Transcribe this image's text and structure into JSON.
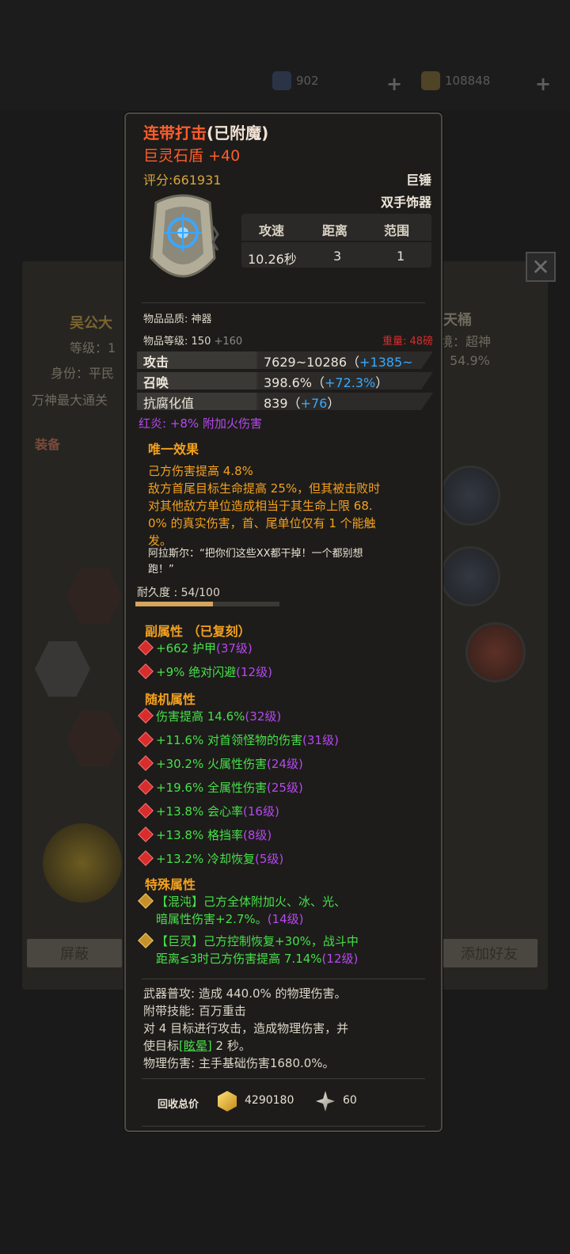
{
  "background": {
    "currency1": "902",
    "currency2": "108848",
    "left_name": "吴公大",
    "left_level": "等级：1",
    "left_identity": "身份：平民",
    "left_title": "万神最大通关",
    "right_name": "天桶",
    "right_realm": "境：超神",
    "right_percent": "54.9%",
    "equip_label": "装备",
    "block_button": "屏蔽",
    "add_friend_button": "添加好友"
  },
  "item": {
    "enchant_name": "连带打击",
    "enchant_state": "(已附魔)",
    "name": "巨灵石盾",
    "level_plus": "+40",
    "score": "评分:661931",
    "category": "巨锤",
    "slot": "双手饰器",
    "stat_headers": [
      "攻速",
      "距离",
      "范围"
    ],
    "stat_values": [
      "10.26秒",
      "3",
      "1"
    ],
    "quality": "物品品质: 神器",
    "level_label": "物品等级:",
    "level_value": "150",
    "level_bonus": "+160",
    "weight": "重量: 48磅",
    "main_stats": [
      {
        "label": "攻击",
        "value": "7629~10286（",
        "bonus": "+1385~",
        "close": ""
      },
      {
        "label": "召唤",
        "value": "398.6%（",
        "bonus": "+72.3%",
        "close": "）"
      },
      {
        "label": "抗腐化值",
        "value": "839（",
        "bonus": "+76",
        "close": "）"
      }
    ],
    "fire_line": "红炎: +8% 附加火伤害",
    "unique_title": "唯一效果",
    "unique_lines": [
      "己方伤害提高 4.8%",
      "敌方首尾目标生命提高 25%，但其被击败时",
      "对其他敌方单位造成相当于其生命上限 68.",
      "0% 的真实伤害，首、尾单位仅有 1 个能触",
      "发。"
    ],
    "quote_lines": [
      "阿拉斯尔：“把你们这些XX都干掉！一个都别想",
      "跑！”"
    ],
    "durability_label": "耐久度 : 54/100",
    "durability_fraction": 0.54,
    "sub_title": "副属性 （已复刻）",
    "sub_attrs": [
      {
        "text": "+662 护甲",
        "level": "(37级)"
      },
      {
        "text": "+9% 绝对闪避",
        "level": "(12级)"
      }
    ],
    "random_title": "随机属性",
    "random_attrs": [
      {
        "text": "伤害提高 14.6%",
        "level": "(32级)"
      },
      {
        "text": "+11.6% 对首领怪物的伤害",
        "level": "(31级)"
      },
      {
        "text": "+30.2% 火属性伤害",
        "level": "(24级)"
      },
      {
        "text": "+19.6% 全属性伤害",
        "level": "(25级)"
      },
      {
        "text": "+13.8% 会心率",
        "level": "(16级)"
      },
      {
        "text": "+13.8% 格挡率",
        "level": "(8级)"
      },
      {
        "text": "+13.2% 冷却恢复",
        "level": "(5级)"
      }
    ],
    "special_title": "特殊属性",
    "special_attrs": [
      {
        "line1": "【混沌】己方全体附加火、冰、光、",
        "line2": "暗属性伤害+2.7%。",
        "level": "(14级)"
      },
      {
        "line1": "【巨灵】己方控制恢复+30%，战斗中",
        "line2": "距离≤3时己方伤害提高 7.14%",
        "level": "(12级)"
      }
    ],
    "weapon_lines": [
      "武器普攻: 造成 440.0% 的物理伤害。",
      "附带技能: 百万重击"
    ],
    "skill_line1": "对 4 目标进行攻击，造成物理伤害，并",
    "skill_line2_pre": "使目标",
    "skill_line2_link": "[眩晕]",
    "skill_line2_post": " 2 秒。",
    "physical_line": "物理伤害: 主手基础伤害1680.0%。",
    "recycle_label": "回收总价",
    "recycle_gold": "4290180",
    "recycle_crystal": "60"
  }
}
